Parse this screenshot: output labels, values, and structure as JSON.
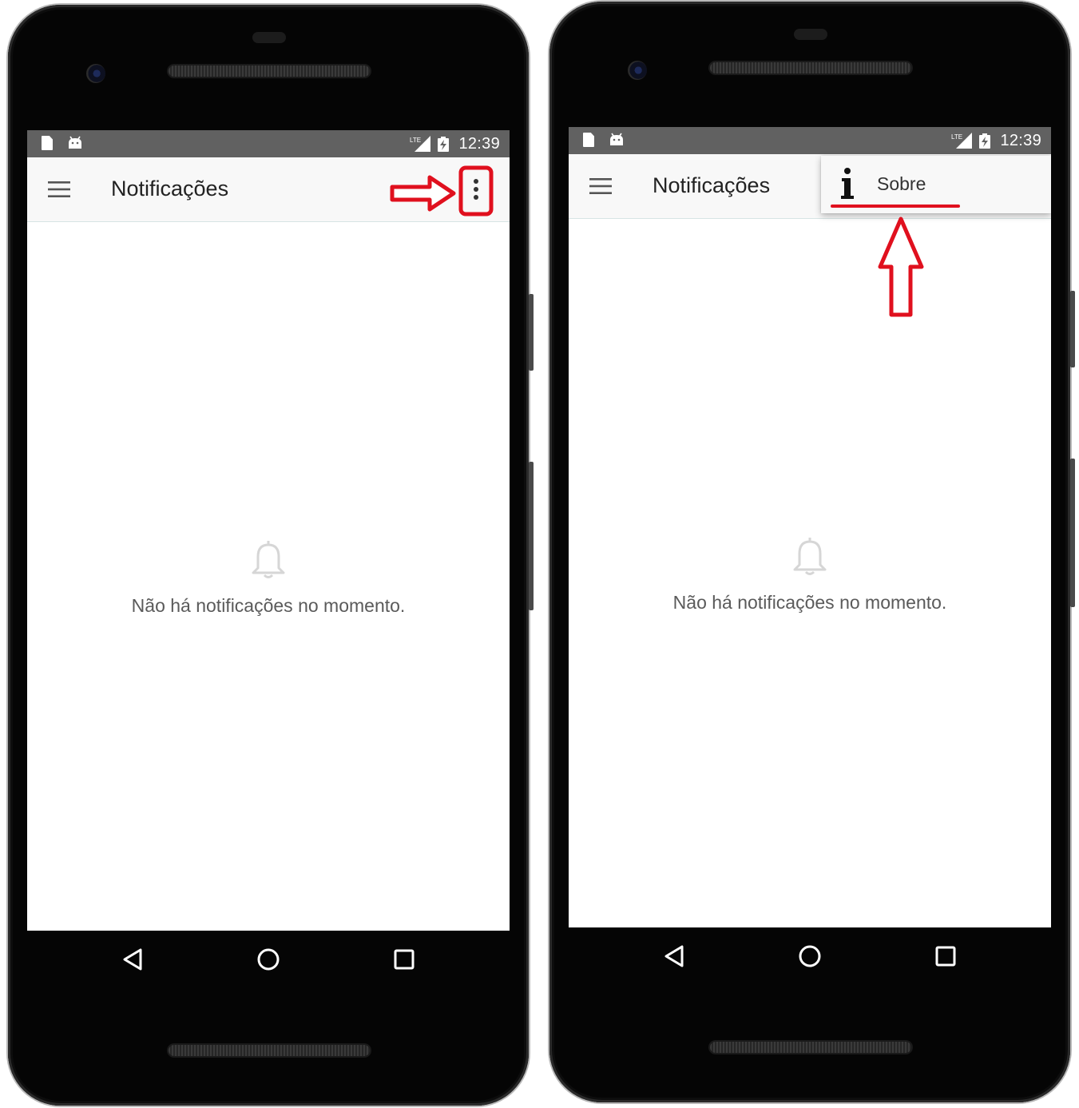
{
  "screens": [
    {
      "status_bar": {
        "time": "12:39",
        "network": "LTE"
      },
      "app_bar": {
        "title": "Notificações",
        "menu_icon": "hamburger-menu-icon",
        "overflow_icon": "more-vert-icon"
      },
      "empty_state": {
        "icon": "bell-icon",
        "message": "Não há notificações no momento."
      },
      "nav_bar": {
        "back": "back-triangle-icon",
        "home": "home-circle-icon",
        "recents": "recents-square-icon"
      }
    },
    {
      "status_bar": {
        "time": "12:39",
        "network": "LTE"
      },
      "app_bar": {
        "title": "Notificações",
        "menu_icon": "hamburger-menu-icon"
      },
      "popup_menu": {
        "items": [
          {
            "icon": "info-icon",
            "label": "Sobre"
          }
        ]
      },
      "empty_state": {
        "icon": "bell-icon",
        "message": "Não há notificações no momento."
      },
      "nav_bar": {
        "back": "back-triangle-icon",
        "home": "home-circle-icon",
        "recents": "recents-square-icon"
      }
    }
  ],
  "colors": {
    "status_bar": "#616161",
    "app_bar": "#f8f8f8",
    "annotation": "#e0101e",
    "empty_text": "#5a5a5a",
    "bell": "#d6d6d6"
  }
}
